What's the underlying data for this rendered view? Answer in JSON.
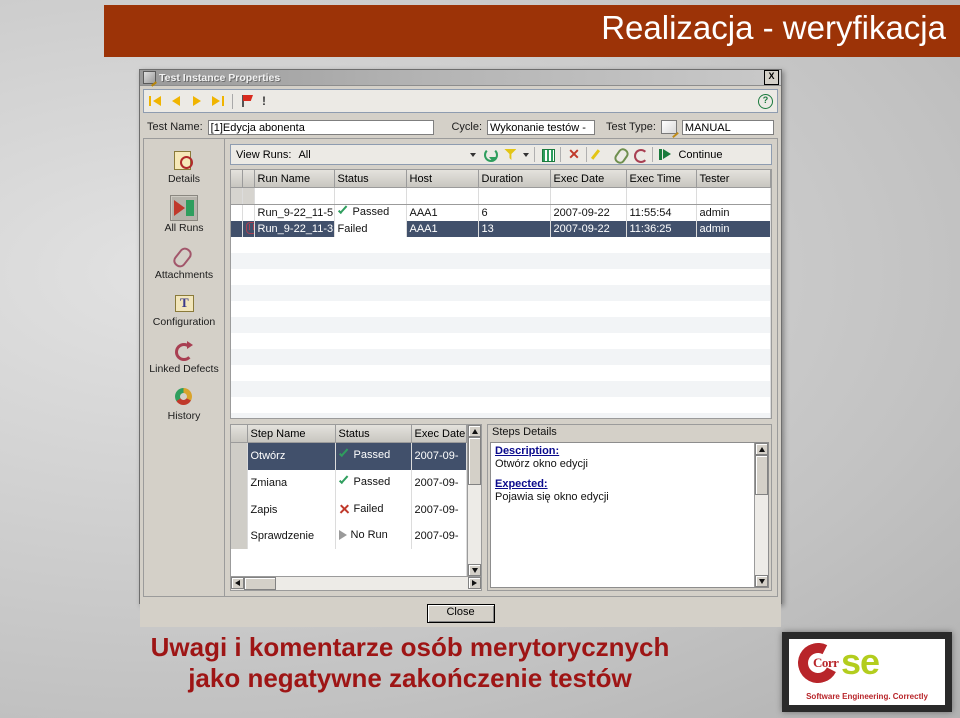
{
  "slide": {
    "banner_title": "Realizacja - weryfikacja",
    "banner_color": "#9c3307",
    "caption_line1": "Uwagi i komentarze osób merytorycznych",
    "caption_line2": "jako negatywne zakończenie testów",
    "caption_color": "#9e1515"
  },
  "dialog": {
    "title": "Test Instance Properties",
    "close_label": "X",
    "nav": {
      "first": "first-record",
      "prev": "previous-record",
      "next": "next-record",
      "last": "last-record",
      "flag": "flag",
      "alert": "!",
      "help": "?"
    },
    "fields": {
      "test_name_label": "Test Name:",
      "test_name_value": "[1]Edycja abonenta",
      "cycle_label": "Cycle:",
      "cycle_value": "Wykonanie testów -",
      "test_type_label": "Test Type:",
      "test_type_value": "MANUAL"
    },
    "footer": {
      "close_button": "Close"
    }
  },
  "sidebar": {
    "items": [
      {
        "label": "Details",
        "icon": "details-icon",
        "selected": false
      },
      {
        "label": "All Runs",
        "icon": "all-runs-icon",
        "selected": true
      },
      {
        "label": "Attachments",
        "icon": "attachments-icon",
        "selected": false
      },
      {
        "label": "Configuration",
        "icon": "configuration-icon",
        "selected": false
      },
      {
        "label": "Linked Defects",
        "icon": "linked-defects-icon",
        "selected": false
      },
      {
        "label": "History",
        "icon": "history-icon",
        "selected": false
      }
    ]
  },
  "runs_toolbar": {
    "view_runs_label": "View Runs:",
    "view_runs_value": "All",
    "buttons": [
      {
        "name": "refresh-icon"
      },
      {
        "name": "filter-icon"
      },
      {
        "name": "select-columns-icon"
      },
      {
        "name": "delete-icon"
      },
      {
        "name": "edit-icon"
      },
      {
        "name": "attachment-icon"
      },
      {
        "name": "rerun-icon"
      }
    ],
    "continue_label": "Continue"
  },
  "runs_grid": {
    "columns": [
      "Run Name",
      "Status",
      "Host",
      "Duration",
      "Exec Date",
      "Exec Time",
      "Tester"
    ],
    "filter_row": [
      "",
      "",
      "",
      "",
      "",
      "",
      ""
    ],
    "rows": [
      {
        "selected": false,
        "has_defect": false,
        "run_name": "Run_9-22_11-5",
        "status": "Passed",
        "status_icon": "check-icon",
        "host": "AAA1",
        "duration": "6",
        "exec_date": "2007-09-22",
        "exec_time": "11:55:54",
        "tester": "admin"
      },
      {
        "selected": true,
        "has_defect": true,
        "run_name": "Run_9-22_11-3",
        "status": "Failed",
        "status_icon": "none",
        "host": "AAA1",
        "duration": "13",
        "exec_date": "2007-09-22",
        "exec_time": "11:36:25",
        "tester": "admin"
      }
    ]
  },
  "steps_grid": {
    "columns": [
      "Step Name",
      "Status",
      "Exec Date"
    ],
    "rows": [
      {
        "selected": true,
        "step_name": "Otwórz",
        "status": "Passed",
        "status_icon": "check-icon",
        "exec_date": "2007-09-"
      },
      {
        "selected": false,
        "step_name": "Zmiana",
        "status": "Passed",
        "status_icon": "check-icon",
        "exec_date": "2007-09-"
      },
      {
        "selected": false,
        "step_name": "Zapis",
        "status": "Failed",
        "status_icon": "x-icon",
        "exec_date": "2007-09-"
      },
      {
        "selected": false,
        "step_name": "Sprawdzenie",
        "status": "No Run",
        "status_icon": "play-gray-icon",
        "exec_date": "2007-09-"
      }
    ]
  },
  "steps_details": {
    "header": "Steps Details",
    "blocks": [
      {
        "heading": "Description:",
        "text": "Otwórz okno edycji"
      },
      {
        "heading": "Expected:",
        "text": "Pojawia się okno edycji"
      }
    ]
  },
  "logo": {
    "c_text": "Corr",
    "se_text": "se",
    "tagline": "Software Engineering. Correctly"
  }
}
